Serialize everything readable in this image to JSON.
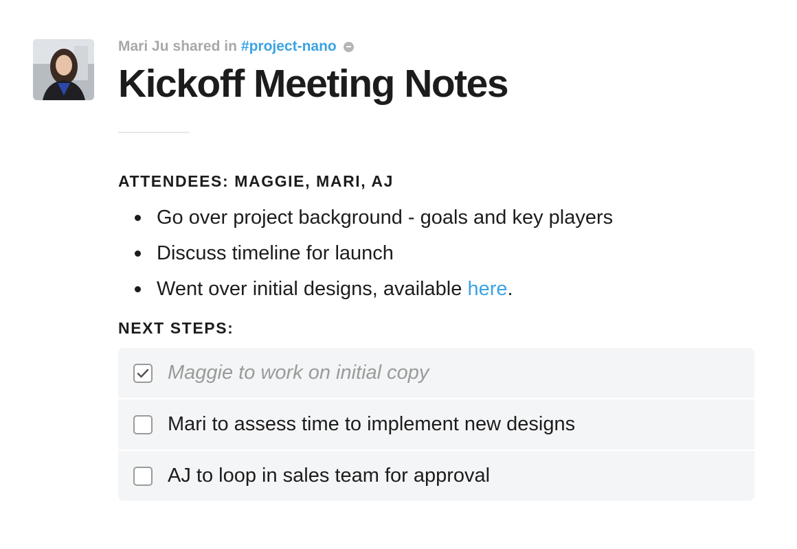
{
  "post": {
    "author": "Mari Ju",
    "shared_text": "shared in",
    "channel": "#project-nano",
    "title": "Kickoff Meeting Notes"
  },
  "attendees": {
    "heading": "ATTENDEES: MAGGIE, MARI, AJ",
    "items": [
      {
        "text": "Go over project background - goals and key players"
      },
      {
        "text": "Discuss timeline for launch"
      },
      {
        "text": "Went over initial designs, available ",
        "link": "here",
        "suffix": "."
      }
    ]
  },
  "next_steps": {
    "heading": "NEXT STEPS:",
    "items": [
      {
        "text": "Maggie to work on initial copy",
        "checked": true
      },
      {
        "text": "Mari to assess time to implement new designs",
        "checked": false
      },
      {
        "text": "AJ to loop in sales team for approval",
        "checked": false
      }
    ]
  },
  "colors": {
    "link": "#3aa3e3",
    "meta_gray": "#a8a8a8",
    "checklist_bg": "#f4f5f6"
  },
  "icons": {
    "avatar": "user-avatar",
    "shared": "shared-channel-icon",
    "checkbox": "checkbox-icon",
    "check": "check-icon"
  }
}
